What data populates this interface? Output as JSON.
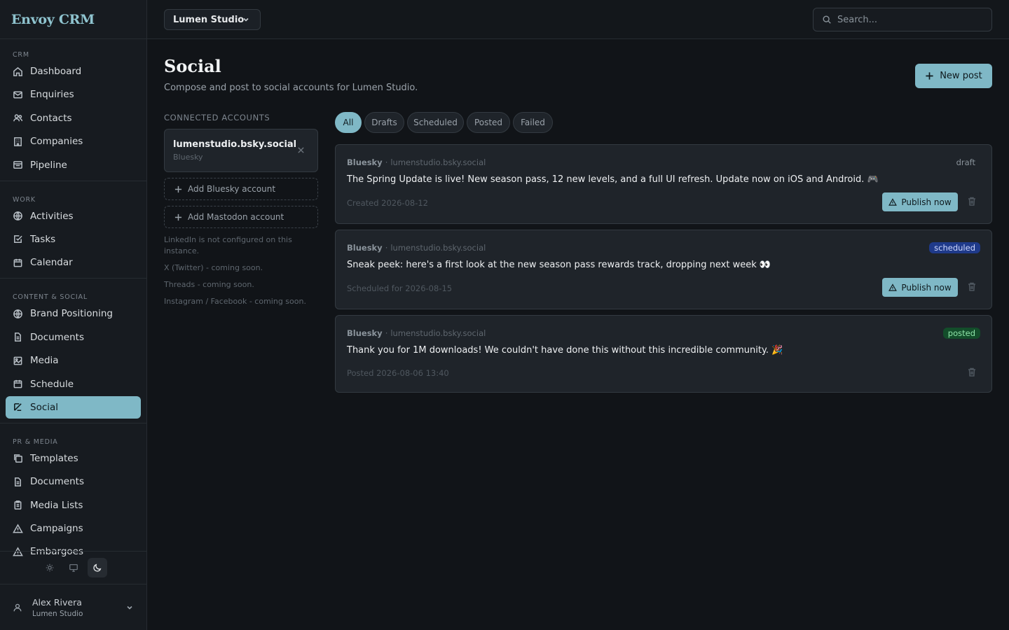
{
  "app": {
    "brand": "Envoy CRM"
  },
  "sidebar": {
    "sections": [
      {
        "title": "CRM",
        "items": [
          "Dashboard",
          "Enquiries",
          "Contacts",
          "Companies",
          "Pipeline"
        ]
      },
      {
        "title": "WORK",
        "items": [
          "Activities",
          "Tasks",
          "Calendar"
        ]
      },
      {
        "title": "CONTENT & SOCIAL",
        "items": [
          "Brand Positioning",
          "Documents",
          "Media",
          "Schedule",
          "Social"
        ]
      },
      {
        "title": "PR & MEDIA",
        "items": [
          "Templates",
          "Documents",
          "Media Lists",
          "Campaigns",
          "Embargoes"
        ]
      }
    ],
    "active_item": "Social"
  },
  "user": {
    "name": "Alex Rivera",
    "org": "Lumen Studio"
  },
  "topbar": {
    "org": "Lumen Studio",
    "search_placeholder": "Search..."
  },
  "page": {
    "title": "Social",
    "subtitle": "Compose and post to social accounts for Lumen Studio.",
    "new_post_label": "New post"
  },
  "accounts": {
    "heading": "CONNECTED ACCOUNTS",
    "connected": {
      "handle": "lumenstudio.bsky.social",
      "network": "Bluesky"
    },
    "add_bluesky": "Add Bluesky account",
    "add_mastodon": "Add Mastodon account",
    "notes": [
      "LinkedIn is not configured on this instance.",
      "X (Twitter) - coming soon.",
      "Threads - coming soon.",
      "Instagram / Facebook - coming soon."
    ]
  },
  "filters": {
    "tabs": [
      "All",
      "Drafts",
      "Scheduled",
      "Posted",
      "Failed"
    ],
    "active": "All"
  },
  "posts": [
    {
      "network": "Bluesky",
      "handle": "lumenstudio.bsky.social",
      "text": "The Spring Update is live! New season pass, 12 new levels, and a full UI refresh. Update now on iOS and Android. 🎮",
      "date": "Created 2026-08-12",
      "status": "draft",
      "publish_label": "Publish now"
    },
    {
      "network": "Bluesky",
      "handle": "lumenstudio.bsky.social",
      "text": "Sneak peek: here's a first look at the new season pass rewards track, dropping next week 👀",
      "date": "Scheduled for 2026-08-15",
      "status": "scheduled",
      "publish_label": "Publish now"
    },
    {
      "network": "Bluesky",
      "handle": "lumenstudio.bsky.social",
      "text": "Thank you for 1M downloads! We couldn't have done this without this incredible community. 🎉",
      "date": "Posted 2026-08-06 13:40",
      "status": "posted"
    }
  ],
  "colors": {
    "accent": "#7fb8c6",
    "background": "#111418",
    "scheduled": "#1f3a8a",
    "posted": "#134d2a"
  }
}
